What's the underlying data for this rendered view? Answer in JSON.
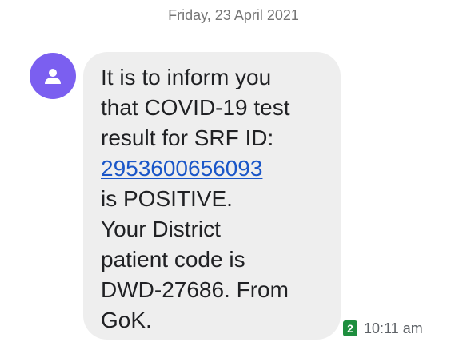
{
  "date_header": "Friday, 23 April 2021",
  "contact": {
    "avatar_icon": "person-icon",
    "avatar_color": "#7b5ff0"
  },
  "message": {
    "lines": [
      "It is to inform you",
      "that COVID-19 test",
      "result for SRF ID:",
      "2953600656093",
      "is POSITIVE.",
      "Your District",
      "patient code is",
      "DWD-27686. From",
      "GoK."
    ],
    "link_color": "#1a56c8",
    "bubble_color": "#eeeeee"
  },
  "meta": {
    "sim_slot": "2",
    "sim_badge_color": "#1e8e3e",
    "time": "10:11 am"
  }
}
